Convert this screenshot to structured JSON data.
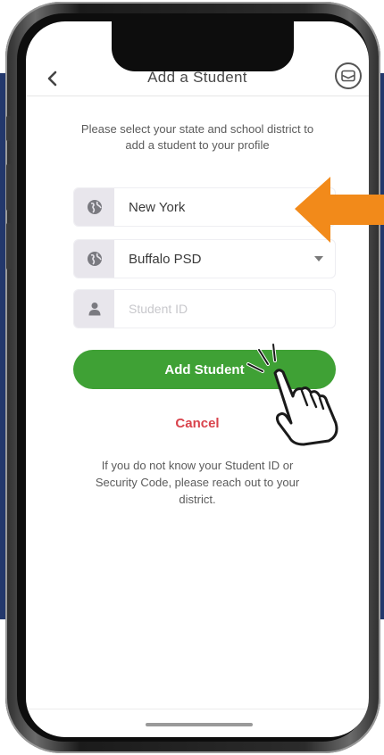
{
  "header": {
    "title": "Add a Student",
    "back_icon": "chevron-left-icon",
    "mail_icon": "mail-icon"
  },
  "instructions": "Please select your state and school district to add a student to your profile",
  "fields": {
    "state": {
      "value": "New York",
      "icon": "globe-icon"
    },
    "district": {
      "value": "Buffalo PSD",
      "icon": "globe-icon",
      "caret": "caret-down-icon"
    },
    "student_id": {
      "placeholder": "Student ID",
      "icon": "person-icon"
    }
  },
  "actions": {
    "add_label": "Add Student",
    "cancel_label": "Cancel"
  },
  "help_text": "If you do not know your Student ID or Security Code, please reach out to your district.",
  "colors": {
    "accent_green": "#3fa135",
    "cancel_red": "#d9434c",
    "annotation_orange": "#f28a1a",
    "background_navy": "#23386c"
  }
}
